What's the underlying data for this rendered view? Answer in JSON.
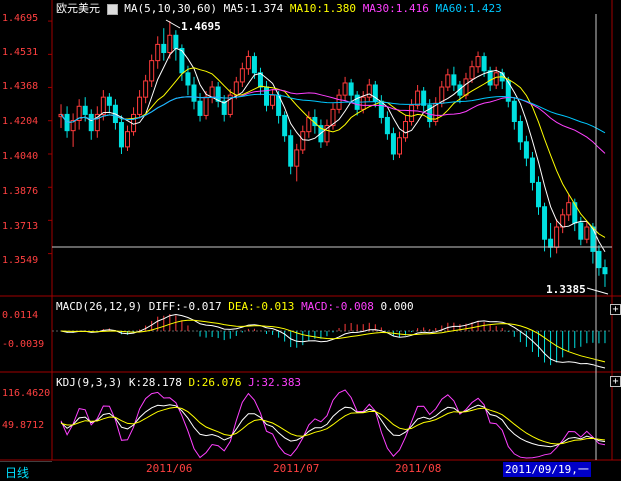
{
  "main": {
    "symbol": "欧元美元",
    "ma_label": "MA(5,10,30,60)",
    "ma5": "MA5:1.374",
    "ma10": "MA10:1.380",
    "ma30": "MA30:1.416",
    "ma60": "MA60:1.423",
    "y_ticks": [
      "1.4695",
      "1.4531",
      "1.4368",
      "1.4204",
      "1.4040",
      "1.3876",
      "1.3713",
      "1.3549"
    ],
    "high_label": "1.4695",
    "low_label": "1.3385",
    "colors": {
      "up": "#ff3c3c",
      "down": "#00e0e0",
      "ma5": "#ffffff",
      "ma10": "#ffff00",
      "ma30": "#ff40ff",
      "ma60": "#00c8ff"
    }
  },
  "macd": {
    "label": "MACD(26,12,9)",
    "diff": "DIFF:-0.017",
    "dea": "DEA:-0.013",
    "macd": "MACD:-0.008",
    "extra": "0.000",
    "y_ticks": [
      "0.0114",
      "-0.0039"
    ]
  },
  "kdj": {
    "label": "KDJ(9,3,3)",
    "k": "K:28.178",
    "d": "D:26.076",
    "j": "J:32.383",
    "y_ticks": [
      "116.4620",
      "49.8712"
    ]
  },
  "footer": {
    "period_tab": "日线",
    "x_labels": [
      "2011/06",
      "2011/07",
      "2011/08"
    ],
    "cursor_date": "2011/09/19,一"
  },
  "chart_data": {
    "type": "candlestick",
    "title": "欧元美元",
    "ylim": [
      1.335,
      1.472
    ],
    "x_ticks": [
      "2011/06",
      "2011/07",
      "2011/08"
    ],
    "high": 1.4695,
    "low": 1.3385,
    "series": [
      {
        "name": "MA5",
        "last": 1.374
      },
      {
        "name": "MA10",
        "last": 1.38
      },
      {
        "name": "MA30",
        "last": 1.416
      },
      {
        "name": "MA60",
        "last": 1.423
      }
    ],
    "candles": [
      [
        1.4224,
        1.4235,
        1.4168,
        1.4285
      ],
      [
        1.4235,
        1.4155,
        1.412,
        1.4275
      ],
      [
        1.4155,
        1.4205,
        1.4075,
        1.424
      ],
      [
        1.4205,
        1.4275,
        1.416,
        1.431
      ],
      [
        1.4275,
        1.4235,
        1.42,
        1.432
      ],
      [
        1.4235,
        1.4155,
        1.411,
        1.426
      ],
      [
        1.4155,
        1.4235,
        1.412,
        1.4275
      ],
      [
        1.4235,
        1.432,
        1.4205,
        1.4355
      ],
      [
        1.432,
        1.428,
        1.424,
        1.434
      ],
      [
        1.428,
        1.4195,
        1.416,
        1.431
      ],
      [
        1.4195,
        1.4075,
        1.404,
        1.423
      ],
      [
        1.4075,
        1.415,
        1.4055,
        1.418
      ],
      [
        1.415,
        1.4235,
        1.413,
        1.427
      ],
      [
        1.4235,
        1.432,
        1.4215,
        1.4355
      ],
      [
        1.432,
        1.44,
        1.429,
        1.443
      ],
      [
        1.44,
        1.45,
        1.437,
        1.453
      ],
      [
        1.45,
        1.458,
        1.446,
        1.462
      ],
      [
        1.458,
        1.454,
        1.45,
        1.466
      ],
      [
        1.454,
        1.4625,
        1.451,
        1.4695
      ],
      [
        1.4625,
        1.456,
        1.45,
        1.465
      ],
      [
        1.456,
        1.444,
        1.44,
        1.458
      ],
      [
        1.444,
        1.438,
        1.433,
        1.4475
      ],
      [
        1.438,
        1.43,
        1.426,
        1.442
      ],
      [
        1.43,
        1.423,
        1.42,
        1.434
      ],
      [
        1.423,
        1.432,
        1.421,
        1.435
      ],
      [
        1.432,
        1.437,
        1.429,
        1.44
      ],
      [
        1.437,
        1.43,
        1.427,
        1.4395
      ],
      [
        1.43,
        1.4235,
        1.42,
        1.433
      ],
      [
        1.4235,
        1.433,
        1.422,
        1.436
      ],
      [
        1.433,
        1.4395,
        1.431,
        1.442
      ],
      [
        1.4395,
        1.446,
        1.437,
        1.449
      ],
      [
        1.446,
        1.452,
        1.443,
        1.455
      ],
      [
        1.452,
        1.444,
        1.441,
        1.454
      ],
      [
        1.444,
        1.437,
        1.433,
        1.4465
      ],
      [
        1.437,
        1.428,
        1.425,
        1.44
      ],
      [
        1.428,
        1.433,
        1.426,
        1.436
      ],
      [
        1.433,
        1.423,
        1.419,
        1.435
      ],
      [
        1.423,
        1.413,
        1.41,
        1.425
      ],
      [
        1.413,
        1.398,
        1.394,
        1.416
      ],
      [
        1.398,
        1.406,
        1.3905,
        1.409
      ],
      [
        1.406,
        1.415,
        1.404,
        1.418
      ],
      [
        1.415,
        1.422,
        1.412,
        1.425
      ],
      [
        1.422,
        1.418,
        1.414,
        1.426
      ],
      [
        1.418,
        1.41,
        1.407,
        1.421
      ],
      [
        1.41,
        1.418,
        1.408,
        1.421
      ],
      [
        1.418,
        1.426,
        1.416,
        1.429
      ],
      [
        1.426,
        1.433,
        1.424,
        1.436
      ],
      [
        1.433,
        1.439,
        1.43,
        1.442
      ],
      [
        1.439,
        1.433,
        1.43,
        1.441
      ],
      [
        1.433,
        1.426,
        1.423,
        1.435
      ],
      [
        1.426,
        1.432,
        1.424,
        1.435
      ],
      [
        1.432,
        1.438,
        1.43,
        1.441
      ],
      [
        1.438,
        1.43,
        1.427,
        1.44
      ],
      [
        1.43,
        1.422,
        1.419,
        1.433
      ],
      [
        1.422,
        1.414,
        1.411,
        1.425
      ],
      [
        1.414,
        1.404,
        1.401,
        1.417
      ],
      [
        1.404,
        1.412,
        1.402,
        1.415
      ],
      [
        1.412,
        1.42,
        1.41,
        1.423
      ],
      [
        1.42,
        1.428,
        1.418,
        1.431
      ],
      [
        1.428,
        1.435,
        1.426,
        1.438
      ],
      [
        1.435,
        1.428,
        1.425,
        1.437
      ],
      [
        1.428,
        1.42,
        1.417,
        1.431
      ],
      [
        1.42,
        1.429,
        1.418,
        1.432
      ],
      [
        1.429,
        1.437,
        1.427,
        1.44
      ],
      [
        1.437,
        1.443,
        1.435,
        1.446
      ],
      [
        1.443,
        1.438,
        1.435,
        1.447
      ],
      [
        1.438,
        1.433,
        1.429,
        1.44
      ],
      [
        1.433,
        1.441,
        1.431,
        1.444
      ],
      [
        1.441,
        1.447,
        1.439,
        1.45
      ],
      [
        1.447,
        1.452,
        1.444,
        1.4545
      ],
      [
        1.452,
        1.445,
        1.442,
        1.454
      ],
      [
        1.445,
        1.438,
        1.435,
        1.447
      ],
      [
        1.438,
        1.444,
        1.436,
        1.447
      ],
      [
        1.444,
        1.44,
        1.436,
        1.446
      ],
      [
        1.44,
        1.43,
        1.427,
        1.442
      ],
      [
        1.43,
        1.42,
        1.416,
        1.432
      ],
      [
        1.42,
        1.41,
        1.406,
        1.423
      ],
      [
        1.41,
        1.402,
        1.398,
        1.413
      ],
      [
        1.402,
        1.39,
        1.386,
        1.405
      ],
      [
        1.39,
        1.378,
        1.374,
        1.393
      ],
      [
        1.378,
        1.362,
        1.356,
        1.38
      ],
      [
        1.362,
        1.358,
        1.353,
        1.37
      ],
      [
        1.358,
        1.368,
        1.355,
        1.372
      ],
      [
        1.368,
        1.374,
        1.365,
        1.377
      ],
      [
        1.374,
        1.38,
        1.371,
        1.384
      ],
      [
        1.38,
        1.37,
        1.366,
        1.382
      ],
      [
        1.37,
        1.362,
        1.359,
        1.373
      ],
      [
        1.362,
        1.368,
        1.36,
        1.371
      ],
      [
        1.368,
        1.356,
        1.35,
        1.37
      ],
      [
        1.356,
        1.348,
        1.344,
        1.359
      ],
      [
        1.348,
        1.345,
        1.3385,
        1.352
      ]
    ]
  }
}
